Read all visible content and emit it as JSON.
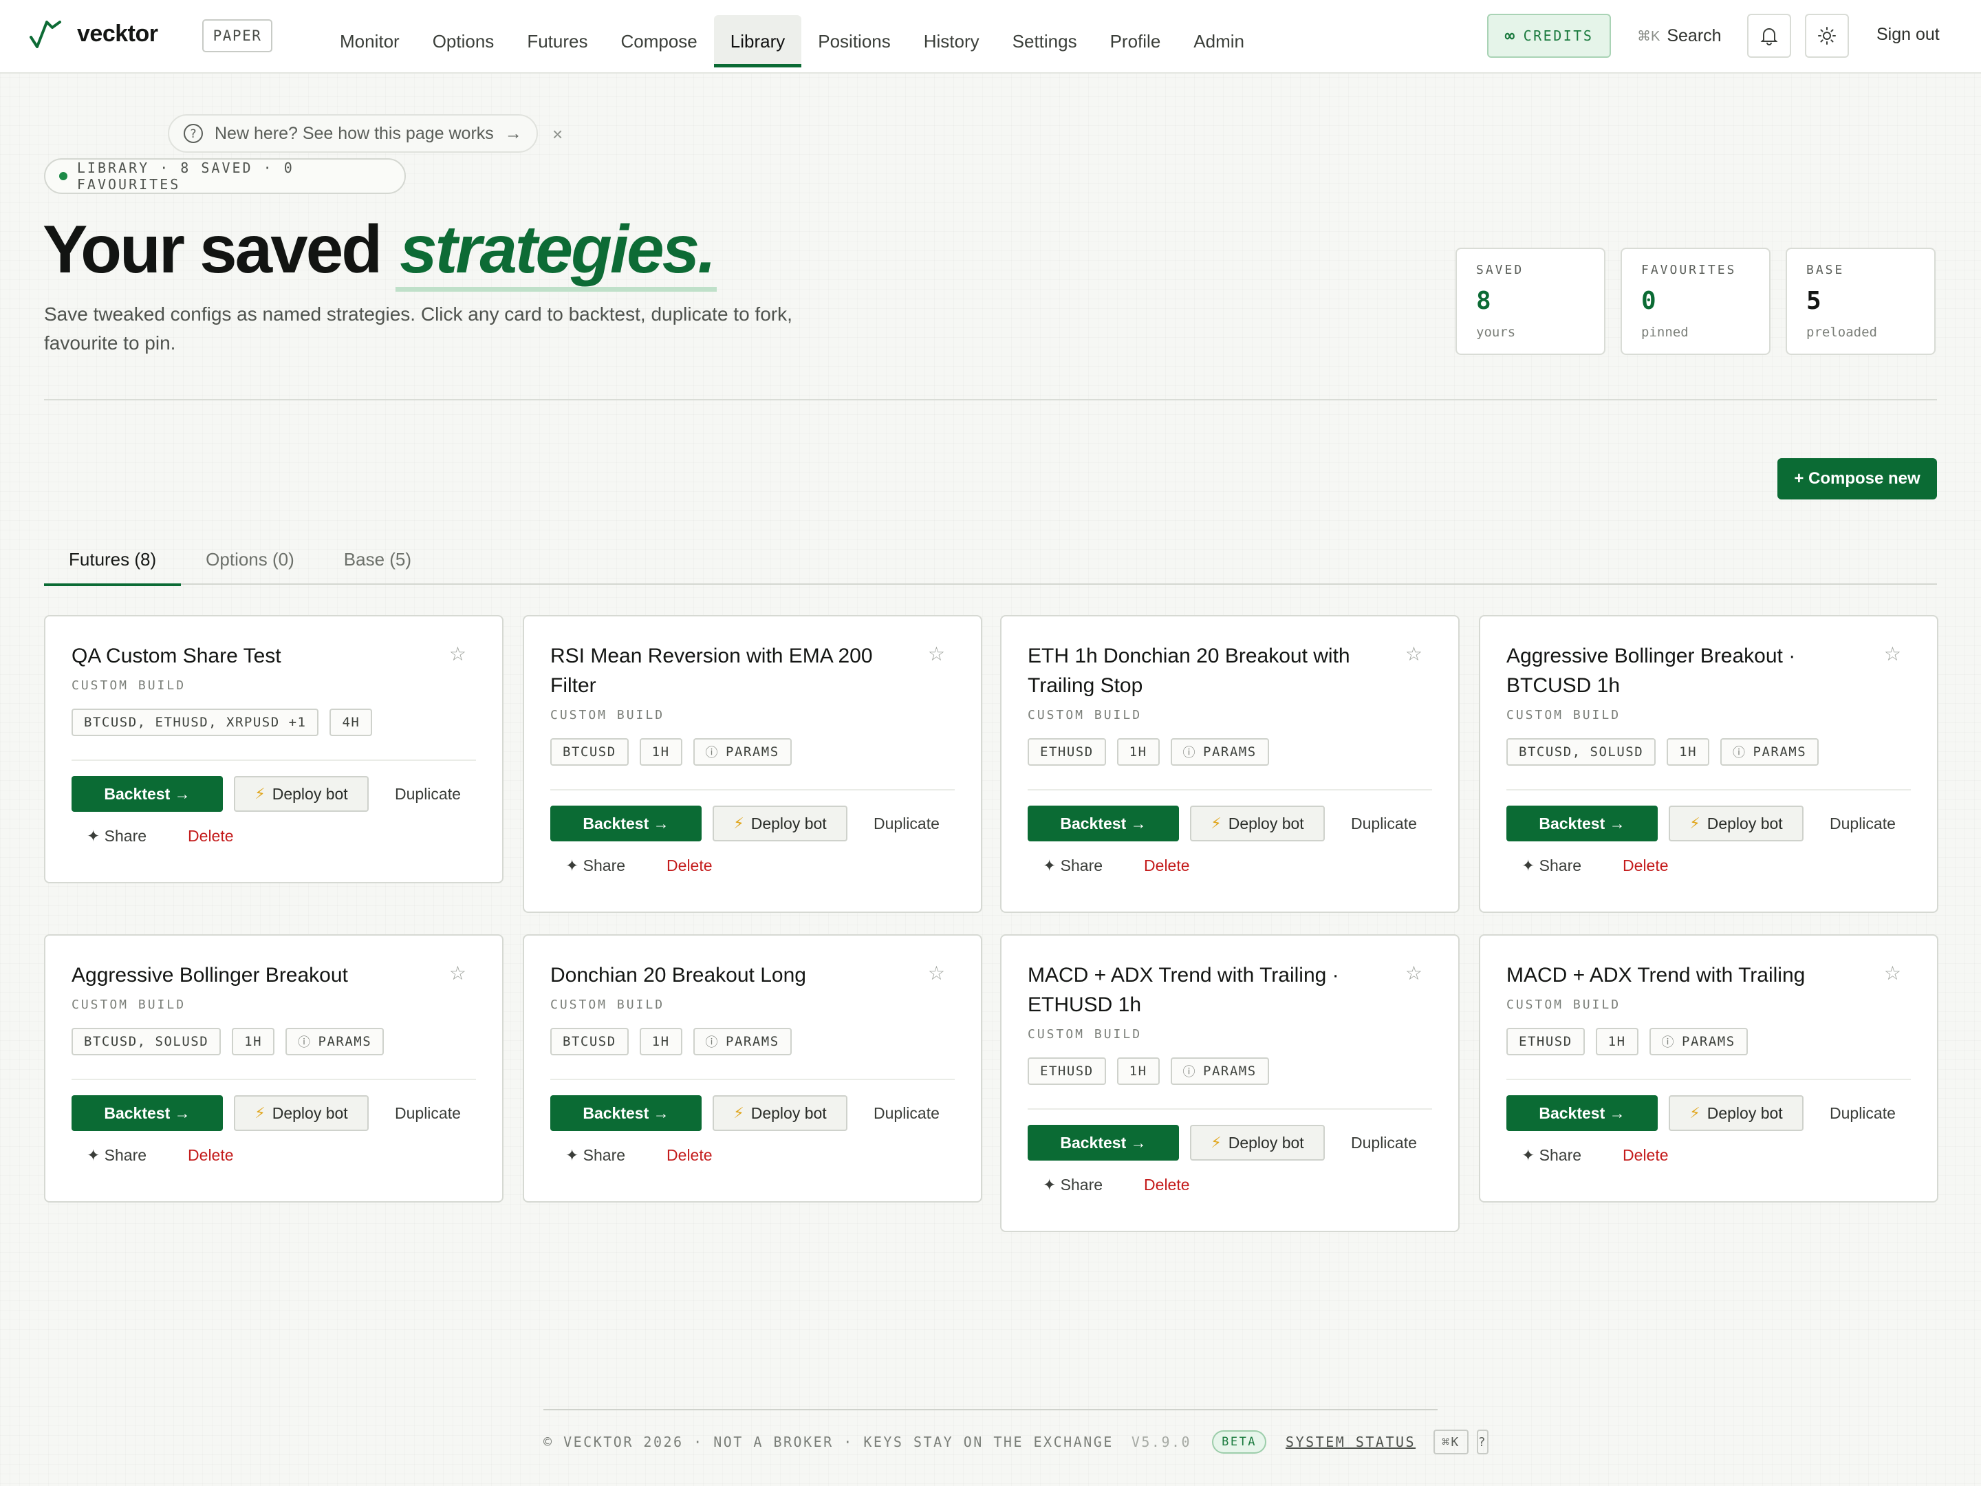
{
  "app": {
    "name": "vecktor",
    "mode_badge": "PAPER"
  },
  "nav": {
    "items": [
      "Monitor",
      "Options",
      "Futures",
      "Compose",
      "Library",
      "Positions",
      "History",
      "Settings",
      "Profile",
      "Admin"
    ],
    "active": "Library"
  },
  "header": {
    "credits_label": "CREDITS",
    "credits_icon": "infinity-icon",
    "search_shortcut": "⌘K",
    "search_label": "Search",
    "notifications_icon": "bell-icon",
    "theme_icon": "sun-icon",
    "signout_label": "Sign out"
  },
  "help": {
    "text": "New here? See how this page works",
    "arrow": "→",
    "close": "×"
  },
  "library_chip": "LIBRARY · 8 SAVED · 0 FAVOURITES",
  "hero": {
    "title_main": "Your saved",
    "title_accent": "strategies.",
    "subtitle": "Save tweaked configs as named strategies. Click any card to backtest, duplicate to fork, favourite to pin."
  },
  "stats": [
    {
      "label": "SAVED",
      "value": "8",
      "sub": "yours",
      "accent": true
    },
    {
      "label": "FAVOURITES",
      "value": "0",
      "sub": "pinned",
      "accent": true
    },
    {
      "label": "BASE",
      "value": "5",
      "sub": "preloaded",
      "accent": false
    }
  ],
  "compose_label": "+ Compose new",
  "tabs": [
    {
      "label": "Futures (8)",
      "active": true
    },
    {
      "label": "Options (0)",
      "active": false
    },
    {
      "label": "Base (5)",
      "active": false
    }
  ],
  "card_actions": {
    "backtest": "Backtest →",
    "deploy": "Deploy bot",
    "deploy_icon": "⚡",
    "duplicate": "Duplicate",
    "share": "✦ Share",
    "delete": "Delete",
    "star": "☆",
    "params_icon": "ⓘ"
  },
  "cards": [
    {
      "title": "QA Custom Share Test",
      "kind": "CUSTOM BUILD",
      "tags": [
        "BTCUSD, ETHUSD, XRPUSD +1",
        "4H"
      ],
      "params": false
    },
    {
      "title": "RSI Mean Reversion with EMA 200 Filter",
      "kind": "CUSTOM BUILD",
      "tags": [
        "BTCUSD",
        "1H"
      ],
      "params": true
    },
    {
      "title": "ETH 1h Donchian 20 Breakout with Trailing Stop",
      "kind": "CUSTOM BUILD",
      "tags": [
        "ETHUSD",
        "1H"
      ],
      "params": true
    },
    {
      "title": "Aggressive Bollinger Breakout · BTCUSD 1h",
      "kind": "CUSTOM BUILD",
      "tags": [
        "BTCUSD, SOLUSD",
        "1H"
      ],
      "params": true
    },
    {
      "title": "Aggressive Bollinger Breakout",
      "kind": "CUSTOM BUILD",
      "tags": [
        "BTCUSD, SOLUSD",
        "1H"
      ],
      "params": true
    },
    {
      "title": "Donchian 20 Breakout Long",
      "kind": "CUSTOM BUILD",
      "tags": [
        "BTCUSD",
        "1H"
      ],
      "params": true
    },
    {
      "title": "MACD + ADX Trend with Trailing · ETHUSD 1h",
      "kind": "CUSTOM BUILD",
      "tags": [
        "ETHUSD",
        "1H"
      ],
      "params": true
    },
    {
      "title": "MACD + ADX Trend with Trailing",
      "kind": "CUSTOM BUILD",
      "tags": [
        "ETHUSD",
        "1H"
      ],
      "params": true
    }
  ],
  "params_label": "PARAMS",
  "footer": {
    "text": "© VECKTOR 2026 · NOT A BROKER · KEYS STAY ON THE EXCHANGE",
    "version": "V5.9.0",
    "beta": "BETA",
    "status": "SYSTEM STATUS",
    "shortcut": "⌘K",
    "help": "?"
  }
}
